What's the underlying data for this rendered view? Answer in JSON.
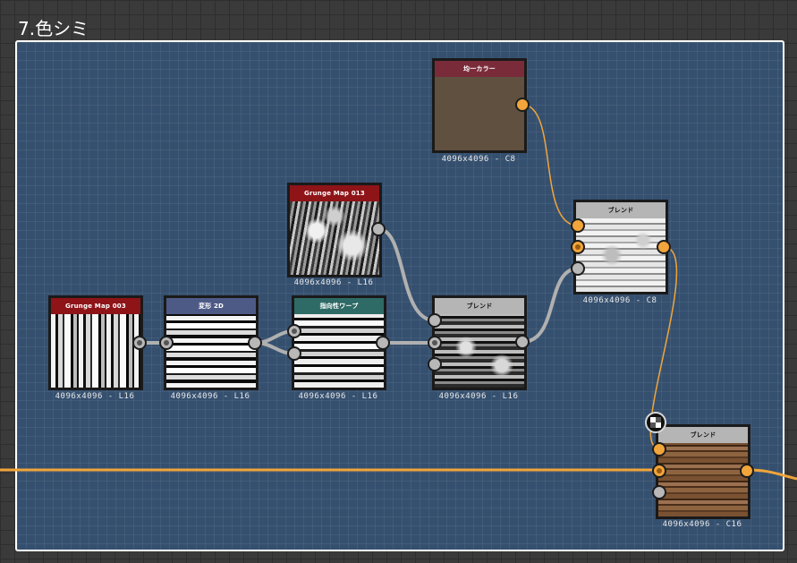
{
  "frame": {
    "title": "7.色シミ"
  },
  "nodes": [
    {
      "id": "grunge003",
      "header": "Grunge Map 003",
      "header_color": "#8e1418",
      "caption": "4096x4096 - L16"
    },
    {
      "id": "warp2d",
      "header": "変形 2D",
      "header_color": "#4e5a86",
      "caption": "4096x4096 - L16"
    },
    {
      "id": "dirwarp",
      "header": "指向性ワープ",
      "header_color": "#2e6a66",
      "caption": "4096x4096 - L16"
    },
    {
      "id": "grunge013",
      "header": "Grunge Map 013",
      "header_color": "#8e1418",
      "caption": "4096x4096 - L16"
    },
    {
      "id": "blend1",
      "header": "ブレンド",
      "header_color": "#b5b5b5",
      "caption": "4096x4096 - L16"
    },
    {
      "id": "uniform",
      "header": "均一カラー",
      "header_color": "#7a2b3a",
      "caption": "4096x4096 - C8",
      "fill_color": "#5f503f"
    },
    {
      "id": "blend2",
      "header": "ブレンド",
      "header_color": "#b5b5b5",
      "caption": "4096x4096 - C8"
    },
    {
      "id": "blend3",
      "header": "ブレンド",
      "header_color": "#b5b5b5",
      "caption": "4096x4096 - C16"
    }
  ],
  "colors": {
    "frame_bg": "#35506f",
    "grey_wire": "#b0b0b0",
    "orange_wire": "#f2a53a"
  }
}
